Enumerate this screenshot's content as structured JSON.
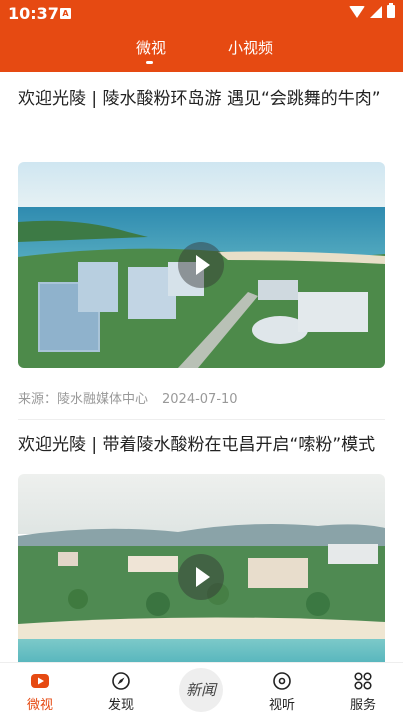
{
  "status_bar": {
    "time": "10:37",
    "notification_icon": "A"
  },
  "tabs": [
    {
      "label": "微视",
      "active": true
    },
    {
      "label": "小视频",
      "active": false
    }
  ],
  "articles": [
    {
      "title": "欢迎光陵 | 陵水酸粉环岛游 遇见“会跳舞的牛肉”",
      "source": "来源：陵水融媒体中心",
      "date": "2024-07-10"
    },
    {
      "title": "欢迎光陵 | 带着陵水酸粉在屯昌开启“嗦粉”模式"
    }
  ],
  "bottom_nav": [
    {
      "label": "微视",
      "icon": "play-circle-icon",
      "active": true
    },
    {
      "label": "发现",
      "icon": "compass-icon",
      "active": false
    },
    {
      "label": "新闻",
      "icon": "news-logo",
      "active": false
    },
    {
      "label": "视听",
      "icon": "disc-icon",
      "active": false
    },
    {
      "label": "服务",
      "icon": "grid-icon",
      "active": false
    }
  ],
  "colors": {
    "accent": "#e64a12",
    "text": "#222222",
    "meta": "#999999"
  }
}
